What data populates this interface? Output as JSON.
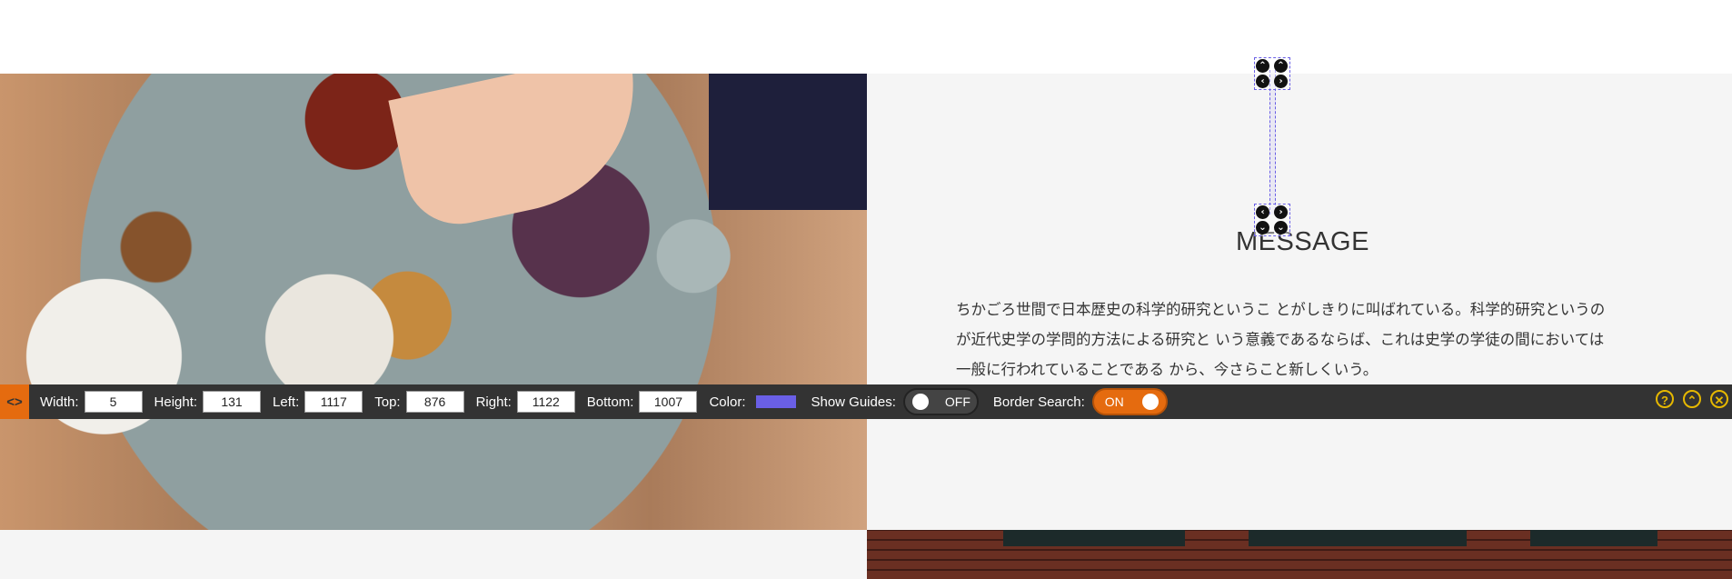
{
  "content": {
    "message_title": "MESSAGE",
    "message_lines": [
      "ちかごろ世間で日本歴史の科学的研究というこ とがしきりに叫ばれている。科学的研究というの",
      "が近代史学の学問的方法による研究と いう意義であるならば、これは史学の学徒の間においては",
      "一般に行われていることである から、今さらこと新しくいう。"
    ]
  },
  "selection_handles": {
    "top": [
      "⌃",
      "⌃",
      "‹",
      "›"
    ],
    "bottom": [
      "‹",
      "›",
      "⌄",
      "⌄"
    ]
  },
  "toolbar": {
    "toggle_icon": "<>",
    "fields": [
      {
        "label": "Width:",
        "value": "5"
      },
      {
        "label": "Height:",
        "value": "131"
      },
      {
        "label": "Left:",
        "value": "1117"
      },
      {
        "label": "Top:",
        "value": "876"
      },
      {
        "label": "Right:",
        "value": "1122"
      },
      {
        "label": "Bottom:",
        "value": "1007"
      }
    ],
    "color_label": "Color:",
    "color_value": "#6a5fe6",
    "show_guides_label": "Show Guides:",
    "show_guides_state": "OFF",
    "border_search_label": "Border Search:",
    "border_search_state": "ON",
    "icons": {
      "help": "?",
      "collapse": "⌃",
      "close": "✕"
    }
  }
}
